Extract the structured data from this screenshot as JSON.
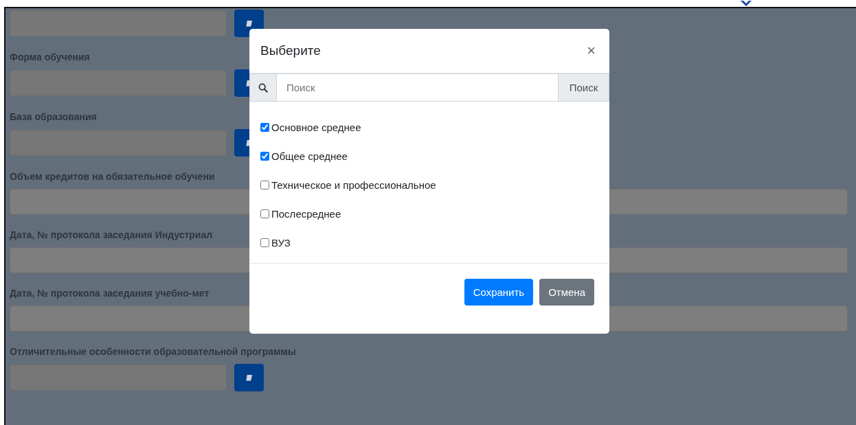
{
  "form": {
    "fields": [
      {
        "kind": "lookup"
      },
      {
        "label": "Форма обучения",
        "kind": "lookup"
      },
      {
        "label": "База образования",
        "kind": "lookup"
      },
      {
        "label": "Объем кредитов на обязательное обучени",
        "kind": "text"
      },
      {
        "label": "Дата, № протокола заседания Индустриал",
        "kind": "text"
      },
      {
        "label": "Дата, № протокола заседания учебно-мет",
        "kind": "text"
      },
      {
        "label": "Отличительные особенности образовательной программы",
        "kind": "lookup"
      }
    ]
  },
  "modal": {
    "title": "Выберите",
    "close": "×",
    "search": {
      "placeholder": "Поиск",
      "button": "Поиск"
    },
    "options": [
      {
        "label": "Основное среднее",
        "checked": true
      },
      {
        "label": "Общее среднее",
        "checked": true
      },
      {
        "label": "Техническое и профессиональное",
        "checked": false
      },
      {
        "label": "Послесреднее",
        "checked": false
      },
      {
        "label": "ВУЗ",
        "checked": false
      }
    ],
    "buttons": [
      {
        "label": "Сохранить",
        "kind": "primary"
      },
      {
        "label": "Отмена",
        "kind": "secondary"
      }
    ]
  }
}
